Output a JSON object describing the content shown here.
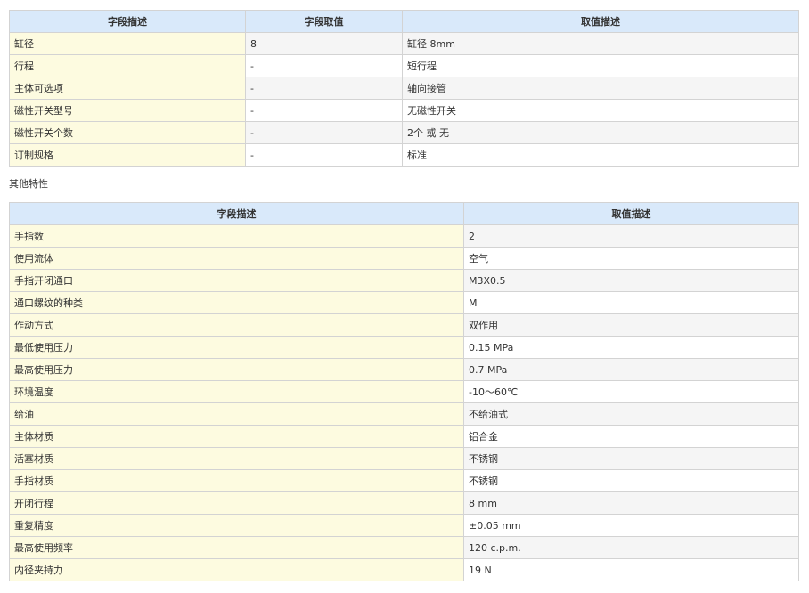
{
  "table1": {
    "headers": [
      "字段描述",
      "字段取值",
      "取值描述"
    ],
    "rows": [
      [
        "缸径",
        "8",
        "缸径 8mm"
      ],
      [
        "行程",
        "-",
        "短行程"
      ],
      [
        "主体可选项",
        "-",
        "轴向接管"
      ],
      [
        "磁性开关型号",
        "-",
        "无磁性开关"
      ],
      [
        "磁性开关个数",
        "-",
        "2个 或 无"
      ],
      [
        "订制规格",
        "-",
        "标准"
      ]
    ]
  },
  "section_title": "其他特性",
  "table2": {
    "headers": [
      "字段描述",
      "取值描述"
    ],
    "rows": [
      [
        "手指数",
        "2"
      ],
      [
        "使用流体",
        "空气"
      ],
      [
        "手指开闭通口",
        "M3X0.5"
      ],
      [
        "通口螺纹的种类",
        "M"
      ],
      [
        "作动方式",
        "双作用"
      ],
      [
        "最低使用压力",
        "0.15 MPa"
      ],
      [
        "最高使用压力",
        "0.7 MPa"
      ],
      [
        "环境温度",
        "-10～60℃"
      ],
      [
        "给油",
        "不给油式"
      ],
      [
        "主体材质",
        "铝合金"
      ],
      [
        "活塞材质",
        "不锈钢"
      ],
      [
        "手指材质",
        "不锈钢"
      ],
      [
        "开闭行程",
        "8 mm"
      ],
      [
        "重复精度",
        "±0.05 mm"
      ],
      [
        "最高使用频率",
        "120 c.p.m."
      ],
      [
        "内径夹持力",
        "19 N"
      ]
    ]
  }
}
